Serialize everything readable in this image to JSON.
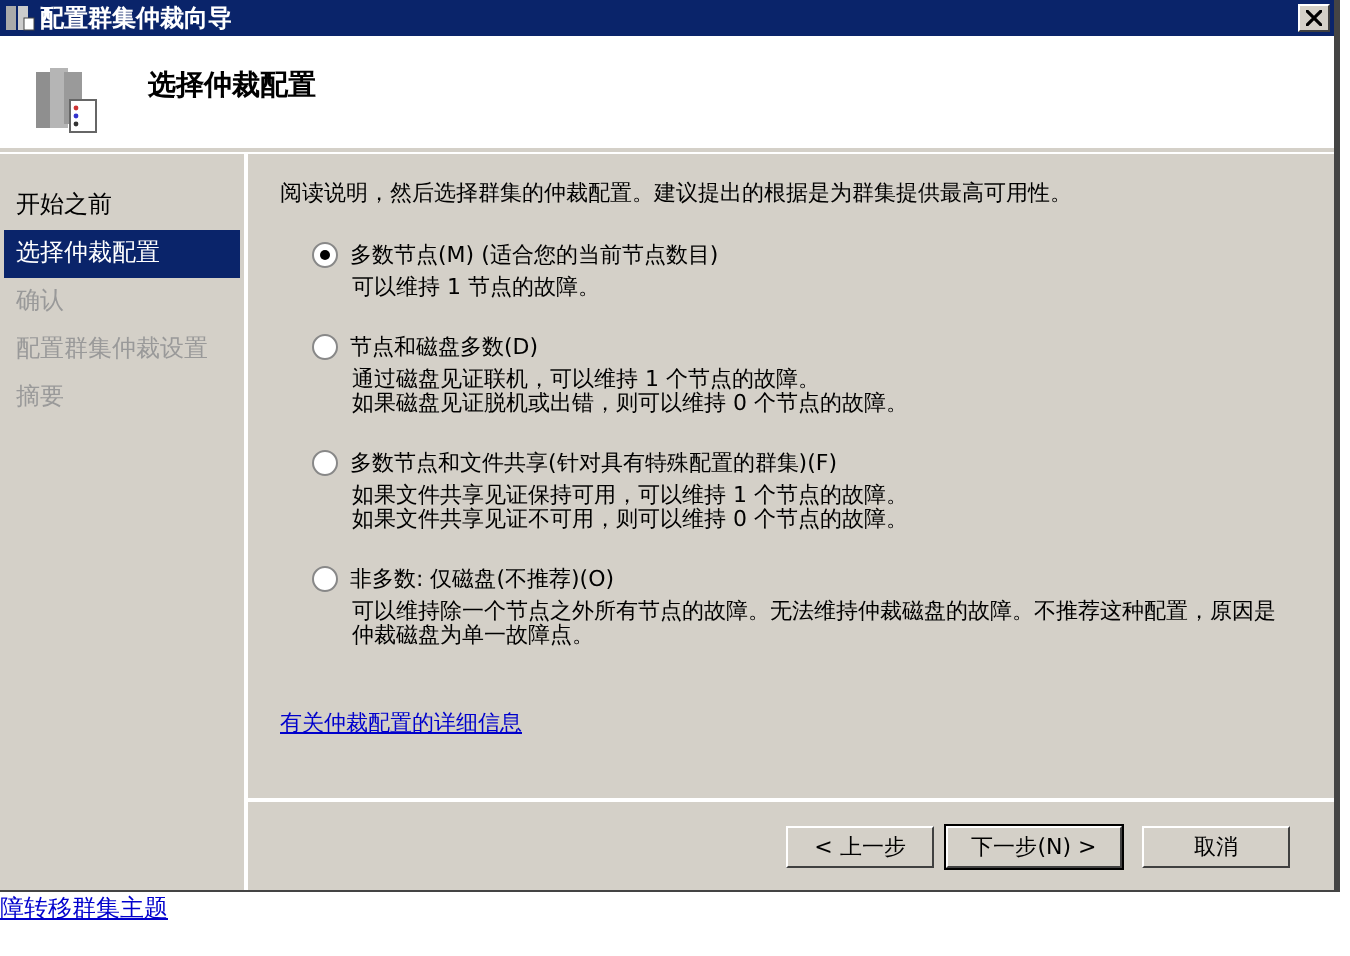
{
  "window": {
    "title": "配置群集仲裁向导"
  },
  "header": {
    "title": "选择仲裁配置"
  },
  "steps": [
    {
      "label": "开始之前",
      "selected": false,
      "disabled": false
    },
    {
      "label": "选择仲裁配置",
      "selected": true,
      "disabled": false
    },
    {
      "label": "确认",
      "selected": false,
      "disabled": true
    },
    {
      "label": "配置群集仲裁设置",
      "selected": false,
      "disabled": true
    },
    {
      "label": "摘要",
      "selected": false,
      "disabled": true
    }
  ],
  "intro": "阅读说明，然后选择群集的仲裁配置。建议提出的根据是为群集提供最高可用性。",
  "options": [
    {
      "label": "多数节点(M) (适合您的当前节点数目)",
      "selected": true,
      "details": [
        "可以维持 1 节点的故障。"
      ]
    },
    {
      "label": "节点和磁盘多数(D)",
      "selected": false,
      "details": [
        "通过磁盘见证联机，可以维持 1 个节点的故障。",
        "如果磁盘见证脱机或出错，则可以维持 0 个节点的故障。"
      ]
    },
    {
      "label": "多数节点和文件共享(针对具有特殊配置的群集)(F)",
      "selected": false,
      "details": [
        "如果文件共享见证保持可用，可以维持 1 个节点的故障。",
        "如果文件共享见证不可用，则可以维持 0 个节点的故障。"
      ]
    },
    {
      "label": "非多数: 仅磁盘(不推荐)(O)",
      "selected": false,
      "details": [
        "可以维持除一个节点之外所有节点的故障。无法维持仲裁磁盘的故障。不推荐这种配置，原因是仲裁磁盘为单一故障点。"
      ]
    }
  ],
  "more_link": "有关仲裁配置的详细信息",
  "buttons": [
    {
      "label": "< 上一步",
      "default": false
    },
    {
      "label": "下一步(N) >",
      "default": true
    },
    {
      "label": "取消",
      "default": false
    }
  ],
  "page_link": "障转移群集主题"
}
